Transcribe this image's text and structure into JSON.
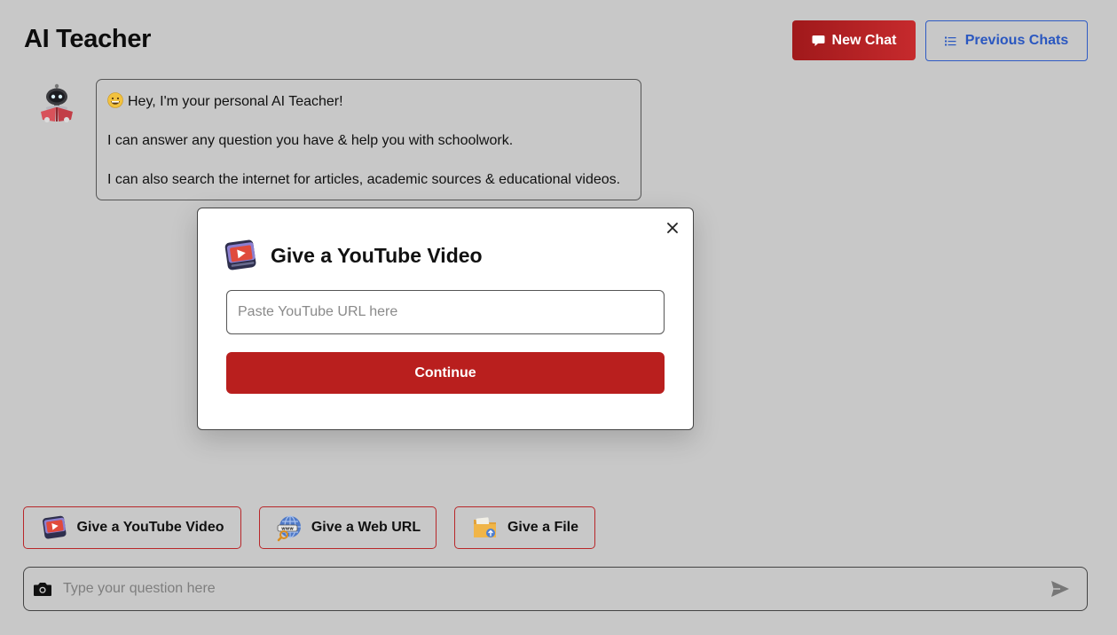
{
  "header": {
    "title": "AI Teacher",
    "new_chat_label": "New Chat",
    "previous_chats_label": "Previous Chats",
    "new_chat_icon": "chat-bubble-icon",
    "previous_chats_icon": "list-icon"
  },
  "message": {
    "avatar_icon": "robot-avatar",
    "emoji": "grinning-face-emoji",
    "greeting": "Hey, I'm your personal AI Teacher!",
    "line2": "I can answer any question you have & help you with schoolwork.",
    "line3": "I can also search the internet for articles, academic sources & educational videos."
  },
  "modal": {
    "title": "Give a YouTube Video",
    "icon": "youtube-video-icon",
    "url_placeholder": "Paste YouTube URL here",
    "url_value": "",
    "continue_label": "Continue",
    "close_icon": "close-icon"
  },
  "sources": {
    "youtube_label": "Give a YouTube Video",
    "web_label": "Give a Web URL",
    "file_label": "Give a File"
  },
  "composer": {
    "placeholder": "Type your question here",
    "camera_icon": "camera-icon",
    "send_icon": "send-icon"
  },
  "colors": {
    "accent_red": "#b91f1e",
    "accent_blue": "#2a57c0",
    "background": "#c8c8c8"
  }
}
